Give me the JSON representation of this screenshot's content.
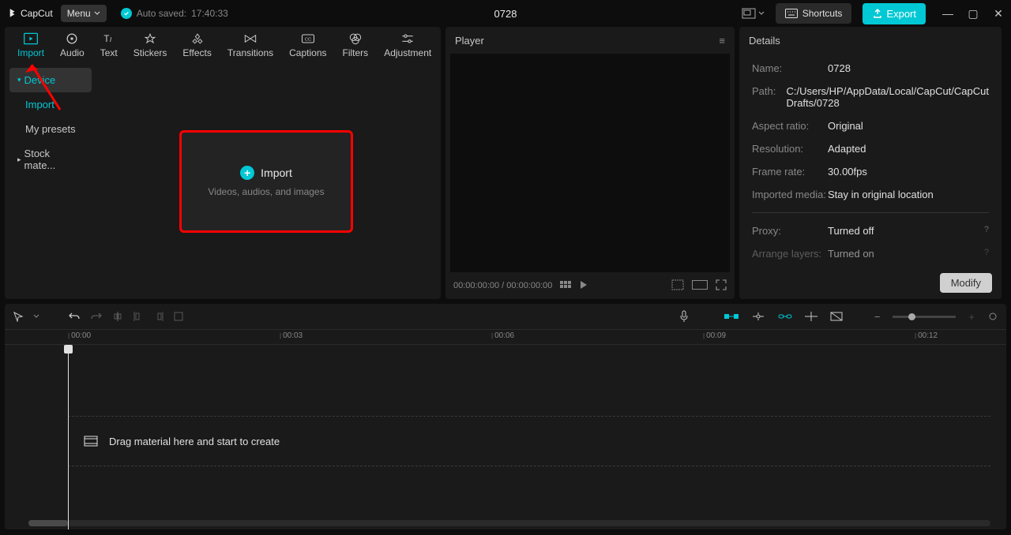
{
  "app": {
    "name": "CapCut",
    "menu_label": "Menu"
  },
  "autosave": {
    "prefix": "Auto saved:",
    "time": "17:40:33"
  },
  "project_name": "0728",
  "titlebar_buttons": {
    "shortcuts": "Shortcuts",
    "export": "Export"
  },
  "tool_tabs": [
    {
      "id": "import",
      "label": "Import"
    },
    {
      "id": "audio",
      "label": "Audio"
    },
    {
      "id": "text",
      "label": "Text"
    },
    {
      "id": "stickers",
      "label": "Stickers"
    },
    {
      "id": "effects",
      "label": "Effects"
    },
    {
      "id": "transitions",
      "label": "Transitions"
    },
    {
      "id": "captions",
      "label": "Captions"
    },
    {
      "id": "filters",
      "label": "Filters"
    },
    {
      "id": "adjustment",
      "label": "Adjustment"
    }
  ],
  "media_sidebar": {
    "device": "Device",
    "import": "Import",
    "presets": "My presets",
    "stock": "Stock mate..."
  },
  "import_box": {
    "title": "Import",
    "subtitle": "Videos, audios, and images"
  },
  "player": {
    "title": "Player",
    "time": "00:00:00:00 / 00:00:00:00"
  },
  "details": {
    "title": "Details",
    "rows": {
      "name_label": "Name:",
      "name_value": "0728",
      "path_label": "Path:",
      "path_value": "C:/Users/HP/AppData/Local/CapCut/CapCut Drafts/0728",
      "ratio_label": "Aspect ratio:",
      "ratio_value": "Original",
      "res_label": "Resolution:",
      "res_value": "Adapted",
      "fps_label": "Frame rate:",
      "fps_value": "30.00fps",
      "media_label": "Imported media:",
      "media_value": "Stay in original location",
      "proxy_label": "Proxy:",
      "proxy_value": "Turned off",
      "layers_label": "Arrange layers:",
      "layers_value": "Turned on"
    },
    "modify": "Modify"
  },
  "timeline": {
    "ticks": [
      "00:00",
      "00:03",
      "00:06",
      "00:09",
      "00:12"
    ],
    "drop_hint": "Drag material here and start to create"
  }
}
